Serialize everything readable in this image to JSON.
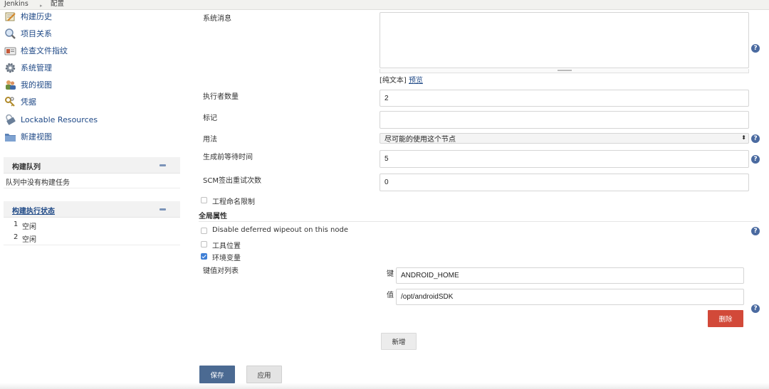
{
  "breadcrumb": {
    "root": "Jenkins",
    "separator": "▸",
    "current": "配置"
  },
  "sidebar": {
    "items": [
      {
        "label": "构建历史",
        "icon": "notepad-icon"
      },
      {
        "label": "项目关系",
        "icon": "magnifier-icon"
      },
      {
        "label": "检查文件指纹",
        "icon": "fingerprint-icon"
      },
      {
        "label": "系统管理",
        "icon": "gear-icon"
      },
      {
        "label": "我的视图",
        "icon": "users-icon"
      },
      {
        "label": "凭据",
        "icon": "keys-icon"
      },
      {
        "label": "Lockable Resources",
        "icon": "lock-icon"
      },
      {
        "label": "新建视图",
        "icon": "folder-icon"
      }
    ]
  },
  "build_queue": {
    "title": "构建队列",
    "empty_text": "队列中没有构建任务"
  },
  "executor_status": {
    "title": "构建执行状态",
    "executors": [
      {
        "number": "1",
        "state": "空闲"
      },
      {
        "number": "2",
        "state": "空闲"
      }
    ]
  },
  "form": {
    "system_message": {
      "label": "系统消息",
      "value": "",
      "markup_plain": "[纯文本]",
      "preview_link": "预览"
    },
    "executors": {
      "label": "执行者数量",
      "value": "2"
    },
    "labels": {
      "label": "标记",
      "value": ""
    },
    "usage": {
      "label": "用法",
      "value": "尽可能的使用这个节点"
    },
    "quiet_period": {
      "label": "生成前等待时间",
      "value": "5"
    },
    "scm_retry": {
      "label": "SCM签出重试次数",
      "value": "0"
    },
    "project_naming": {
      "label": "工程命名限制",
      "checked": false
    },
    "global_properties": {
      "title": "全局属性",
      "disable_wipeout": {
        "label": "Disable deferred wipeout on this node",
        "checked": false
      },
      "tool_locations": {
        "label": "工具位置",
        "checked": false
      },
      "env_vars": {
        "label": "环境变量",
        "checked": true
      },
      "kv_list": {
        "label": "键值对列表",
        "key_label": "键",
        "key_value": "ANDROID_HOME",
        "value_label": "值",
        "value_value": "/opt/androidSDK",
        "delete_button": "删除",
        "add_button": "新增"
      }
    }
  },
  "actions": {
    "save": "保存",
    "apply": "应用"
  },
  "colors": {
    "primary_button": "#4b6a92",
    "delete_button": "#d24939",
    "link": "#204a87",
    "checkbox": "#3f7fd6"
  }
}
